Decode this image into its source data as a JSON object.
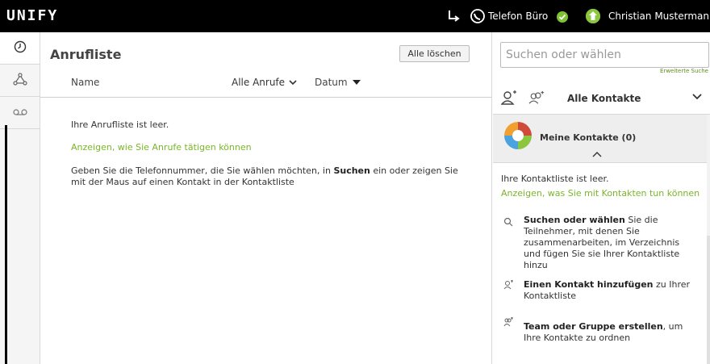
{
  "app": {
    "logo": "UNIFY"
  },
  "topbar": {
    "phone_label": "Telefon Büro",
    "user_name": "Christian Mustermann",
    "status_color": "#7ec135"
  },
  "leftnav": {
    "items": [
      {
        "name": "history-icon",
        "active": true
      },
      {
        "name": "contacts-network-icon",
        "active": false
      },
      {
        "name": "voicemail-icon",
        "active": false
      }
    ]
  },
  "main": {
    "title": "Anrufliste",
    "clear_button": "Alle löschen",
    "columns": {
      "name": "Name",
      "filter": "Alle Anrufe",
      "date": "Datum"
    },
    "empty_text": "Ihre Anrufliste ist leer.",
    "help_link": "Anzeigen, wie Sie Anrufe tätigen können",
    "info_before": "Geben Sie die Telefonnummer, die Sie wählen möchten, in ",
    "info_bold": "Suchen",
    "info_after": " ein oder zeigen Sie mit der Maus auf einen Kontakt in der Kontaktliste"
  },
  "right": {
    "search_placeholder": "Suchen oder wählen",
    "advanced_search": "Erweiterte Suche",
    "contacts_filter": "Alle Kontakte",
    "group_name": "Meine Kontakte (0)",
    "empty_text": "Ihre Kontaktliste ist leer.",
    "help_link": "Anzeigen, was Sie mit Kontakten tun können",
    "tips": [
      {
        "bold": "Suchen oder wählen",
        "text": " Sie die Teilnehmer, mit denen Sie zusammenarbeiten, im Verzeichnis und fügen Sie sie Ihrer Kontaktliste hinzu"
      },
      {
        "bold": "Einen Kontakt hinzufügen",
        "text": " zu Ihrer Kontaktliste"
      },
      {
        "bold": "Team oder Gruppe erstellen",
        "text": ", um Ihre Kontakte zu ordnen"
      }
    ]
  },
  "colors": {
    "accent_green": "#7ab528",
    "topbar_bg": "#000000"
  }
}
